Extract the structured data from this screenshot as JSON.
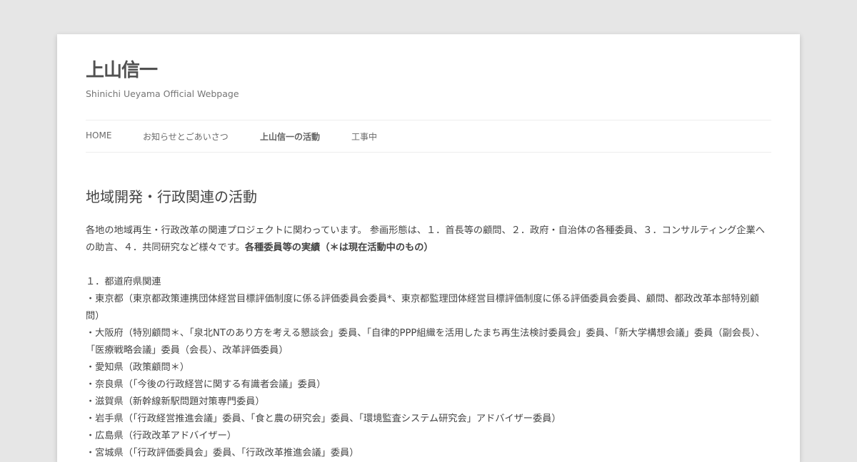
{
  "site": {
    "title": "上山信一",
    "description": "Shinichi Ueyama Official Webpage"
  },
  "nav": {
    "items": [
      {
        "label": "HOME"
      },
      {
        "label": "お知らせとごあいさつ"
      },
      {
        "label": "上山信一の活動"
      },
      {
        "label": "工事中"
      }
    ]
  },
  "content": {
    "title": "地域開発・行政関連の活動",
    "intro": "各地の地域再生・行政改革の関連プロジェクトに関わっています。 参画形態は、１．首長等の顧問、２．政府・自治体の各種委員、３．コンサルティング企業への助言、４．共同研究など様々です。",
    "intro_strong": "各種委員等の実績（＊は現在活動中のもの）",
    "section_heading": "１．都道府県関連",
    "lines": [
      "・東京都（東京都政策連携団体経営目標評価制度に係る評価委員会委員*、東京都監理団体経営目標評価制度に係る評価委員会委員、顧問、都政改革本部特別顧問）",
      "・大阪府（特別顧問＊、「泉北NTのあり方を考える懇談会」委員、「自律的PPP組織を活用したまち再生法検討委員会」委員、「新大学構想会議」委員（副会長）、「医療戦略会議」委員（会長）、改革評価委員）",
      "・愛知県（政策顧問＊）",
      "・奈良県（「今後の行政経営に関する有識者会議」委員）",
      "・滋賀県（新幹線新駅問題対策専門委員）",
      "・岩手県（「行政経営推進会議」委員、「食と農の研究会」委員、「環境監査システム研究会」アドバイザー委員）",
      "・広島県（行政改革アドバイザー）",
      "・宮城県（「行政評価委員会」委員、「行政改革推進会議」委員）"
    ]
  }
}
